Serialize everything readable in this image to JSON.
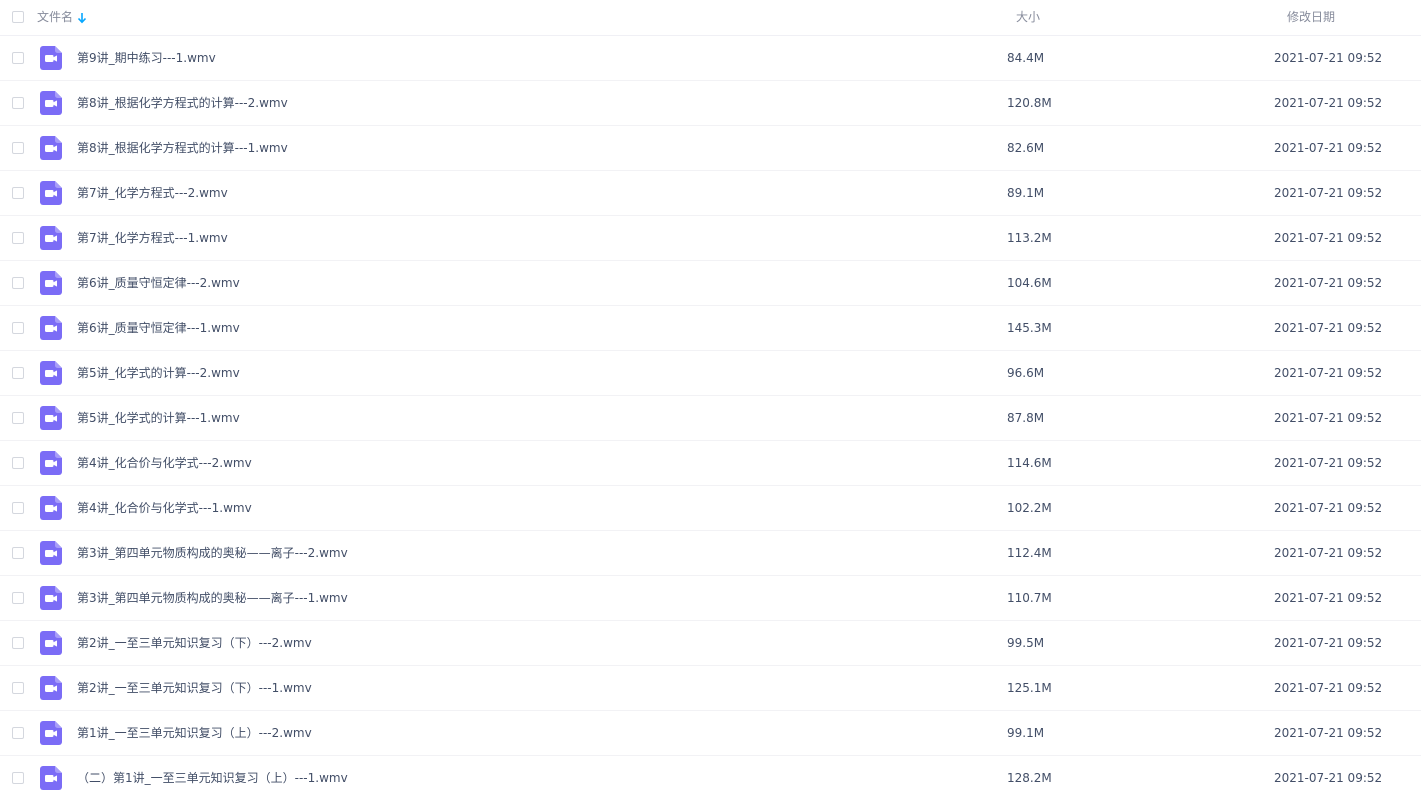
{
  "header": {
    "name_label": "文件名",
    "size_label": "大小",
    "date_label": "修改日期"
  },
  "files": [
    {
      "name": "第9讲_期中练习---1.wmv",
      "size": "84.4M",
      "date": "2021-07-21 09:52"
    },
    {
      "name": "第8讲_根据化学方程式的计算---2.wmv",
      "size": "120.8M",
      "date": "2021-07-21 09:52"
    },
    {
      "name": "第8讲_根据化学方程式的计算---1.wmv",
      "size": "82.6M",
      "date": "2021-07-21 09:52"
    },
    {
      "name": "第7讲_化学方程式---2.wmv",
      "size": "89.1M",
      "date": "2021-07-21 09:52"
    },
    {
      "name": "第7讲_化学方程式---1.wmv",
      "size": "113.2M",
      "date": "2021-07-21 09:52"
    },
    {
      "name": "第6讲_质量守恒定律---2.wmv",
      "size": "104.6M",
      "date": "2021-07-21 09:52"
    },
    {
      "name": "第6讲_质量守恒定律---1.wmv",
      "size": "145.3M",
      "date": "2021-07-21 09:52"
    },
    {
      "name": "第5讲_化学式的计算---2.wmv",
      "size": "96.6M",
      "date": "2021-07-21 09:52"
    },
    {
      "name": "第5讲_化学式的计算---1.wmv",
      "size": "87.8M",
      "date": "2021-07-21 09:52"
    },
    {
      "name": "第4讲_化合价与化学式---2.wmv",
      "size": "114.6M",
      "date": "2021-07-21 09:52"
    },
    {
      "name": "第4讲_化合价与化学式---1.wmv",
      "size": "102.2M",
      "date": "2021-07-21 09:52"
    },
    {
      "name": "第3讲_第四单元物质构成的奥秘——离子---2.wmv",
      "size": "112.4M",
      "date": "2021-07-21 09:52"
    },
    {
      "name": "第3讲_第四单元物质构成的奥秘——离子---1.wmv",
      "size": "110.7M",
      "date": "2021-07-21 09:52"
    },
    {
      "name": "第2讲_一至三单元知识复习（下）---2.wmv",
      "size": "99.5M",
      "date": "2021-07-21 09:52"
    },
    {
      "name": "第2讲_一至三单元知识复习（下）---1.wmv",
      "size": "125.1M",
      "date": "2021-07-21 09:52"
    },
    {
      "name": "第1讲_一至三单元知识复习（上）---2.wmv",
      "size": "99.1M",
      "date": "2021-07-21 09:52"
    },
    {
      "name": "（二）第1讲_一至三单元知识复习（上）---1.wmv",
      "size": "128.2M",
      "date": "2021-07-21 09:52"
    }
  ],
  "icons": {
    "file_icon": "video-file-icon",
    "sort_icon": "arrow-down-icon"
  },
  "colors": {
    "file_icon_bg": "#7b6cf6",
    "sort_arrow": "#06a7ff"
  }
}
